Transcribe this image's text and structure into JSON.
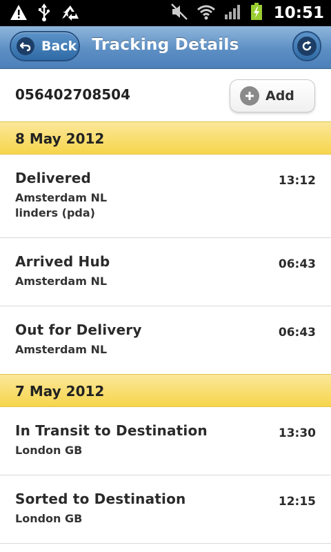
{
  "status_bar": {
    "time": "10:51",
    "icons": [
      "warning-icon",
      "usb-icon",
      "recycle-icon",
      "mute-icon",
      "wifi-icon",
      "signal-icon",
      "battery-charging-icon"
    ]
  },
  "header": {
    "back_label": "Back",
    "title": "Tracking Details",
    "refresh_icon": "refresh-icon",
    "color": "#5d8fc4"
  },
  "tracking": {
    "number": "056402708504",
    "add_label": "Add"
  },
  "groups": [
    {
      "date": "8 May 2012",
      "events": [
        {
          "status": "Delivered",
          "place": "Amsterdam NL",
          "detail": "linders (pda)",
          "time": "13:12"
        },
        {
          "status": "Arrived Hub",
          "place": "Amsterdam NL",
          "time": "06:43"
        },
        {
          "status": "Out for Delivery",
          "place": "Amsterdam NL",
          "time": "06:43"
        }
      ]
    },
    {
      "date": "7 May 2012",
      "events": [
        {
          "status": "In Transit to Destination",
          "place": "London GB",
          "time": "13:30"
        },
        {
          "status": "Sorted to Destination",
          "place": "London GB",
          "time": "12:15"
        }
      ]
    }
  ],
  "colors": {
    "date_header": "#f6d54b",
    "header": "#5d8fc4"
  }
}
